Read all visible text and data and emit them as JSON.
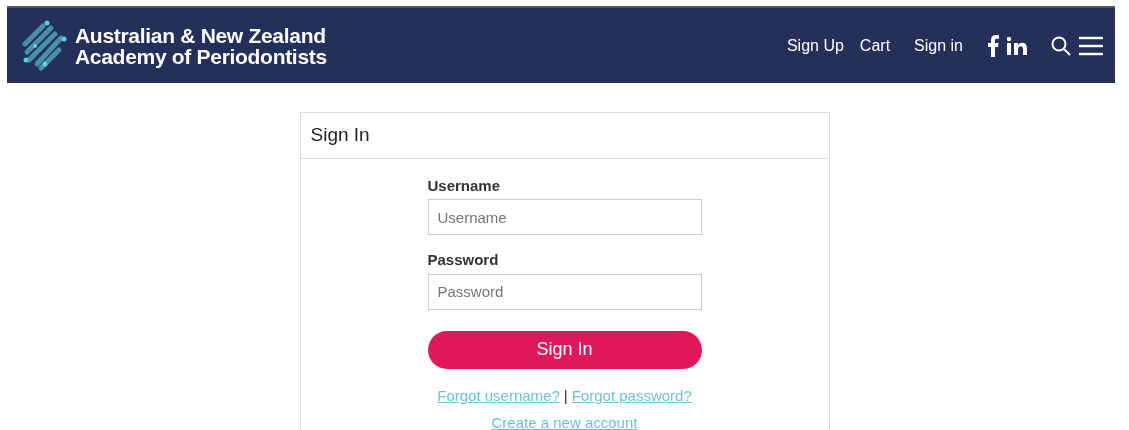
{
  "header": {
    "brand_lines": [
      "Australian & New Zealand",
      "Academy of Periodontists"
    ],
    "nav_links": [
      "Sign Up",
      "Cart",
      "Sign in"
    ]
  },
  "card": {
    "title": "Sign In",
    "fields": [
      {
        "label": "Username",
        "placeholder": "Username"
      },
      {
        "label": "Password",
        "placeholder": "Password"
      }
    ],
    "submit": "Sign In",
    "links": [
      "Forgot username?",
      "Forgot password?"
    ],
    "separator": "|",
    "create_link": "Create a new account"
  }
}
